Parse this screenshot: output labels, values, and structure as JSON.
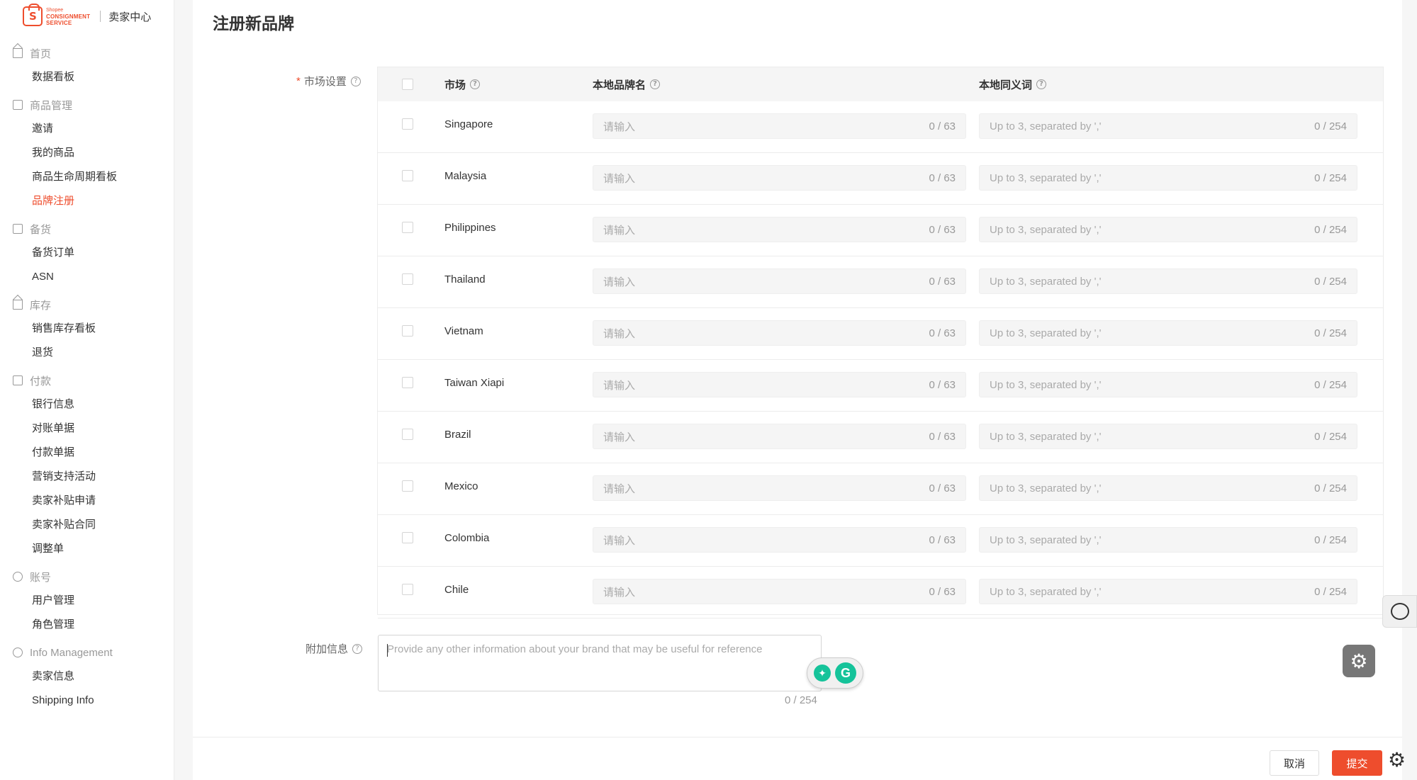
{
  "brand": {
    "logo_line1": "Shopee",
    "logo_line2": "CONSIGNMENT",
    "logo_line3": "SERVICE",
    "center": "卖家中心"
  },
  "sidebar": {
    "groups": [
      {
        "title": "首页",
        "icon": "home-icon",
        "items": [
          "数据看板"
        ]
      },
      {
        "title": "商品管理",
        "icon": "box-icon",
        "items": [
          "邀请",
          "我的商品",
          "商品生命周期看板",
          "品牌注册"
        ]
      },
      {
        "title": "备货",
        "icon": "clipboard-icon",
        "items": [
          "备货订单",
          "ASN"
        ]
      },
      {
        "title": "库存",
        "icon": "warehouse-icon",
        "items": [
          "销售库存看板",
          "退货"
        ]
      },
      {
        "title": "付款",
        "icon": "wallet-icon",
        "items": [
          "银行信息",
          "对账单据",
          "付款单据",
          "营销支持活动",
          "卖家补贴申请",
          "卖家补贴合同",
          "调整单"
        ]
      },
      {
        "title": "账号",
        "icon": "account-icon",
        "items": [
          "用户管理",
          "角色管理"
        ]
      },
      {
        "title": "Info Management",
        "icon": "info-icon",
        "items": [
          "卖家信息",
          "Shipping Info"
        ]
      }
    ],
    "active": "品牌注册"
  },
  "page": {
    "title": "注册新品牌",
    "market_label": "市场设置",
    "extra_label": "附加信息",
    "required_mark": "*"
  },
  "table": {
    "headers": {
      "market": "市场",
      "local_brand": "本地品牌名",
      "local_synonym": "本地同义词"
    },
    "name_placeholder": "请输入",
    "name_count": "0 / 63",
    "syn_placeholder": "Up to 3, separated by ','",
    "syn_count": "0 / 254",
    "markets": [
      "Singapore",
      "Malaysia",
      "Philippines",
      "Thailand",
      "Vietnam",
      "Taiwan Xiapi",
      "Brazil",
      "Mexico",
      "Colombia",
      "Chile"
    ]
  },
  "extra_info": {
    "placeholder": "Provide any other information about your brand that may be useful for reference",
    "count": "0 / 254"
  },
  "footer": {
    "cancel": "取消",
    "submit": "提交"
  },
  "colors": {
    "accent": "#ee4d2d",
    "grammarly": "#15c39a"
  }
}
